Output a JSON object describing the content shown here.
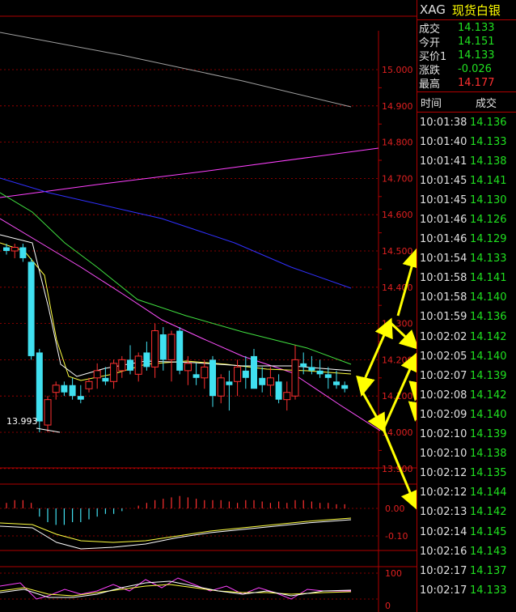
{
  "quote": {
    "symbol": "XAG",
    "name": "现货白银",
    "rows": [
      {
        "label": "成交",
        "value": "14.133",
        "color": "green"
      },
      {
        "label": "今开",
        "value": "14.151",
        "color": "green"
      },
      {
        "label": "买价1",
        "value": "14.133",
        "color": "green"
      },
      {
        "label": "涨跌",
        "value": "-0.026",
        "color": "green"
      },
      {
        "label": "最高",
        "value": "14.177",
        "color": "red"
      }
    ]
  },
  "ticks": {
    "col_time": "时间",
    "col_price": "成交",
    "rows": [
      {
        "time": "10:01:38",
        "price": "14.136"
      },
      {
        "time": "10:01:40",
        "price": "14.133"
      },
      {
        "time": "10:01:41",
        "price": "14.138"
      },
      {
        "time": "10:01:45",
        "price": "14.141"
      },
      {
        "time": "10:01:45",
        "price": "14.130"
      },
      {
        "time": "10:01:46",
        "price": "14.126"
      },
      {
        "time": "10:01:46",
        "price": "14.129"
      },
      {
        "time": "10:01:54",
        "price": "14.133"
      },
      {
        "time": "10:01:58",
        "price": "14.141"
      },
      {
        "time": "10:01:58",
        "price": "14.140"
      },
      {
        "time": "10:01:59",
        "price": "14.136"
      },
      {
        "time": "10:02:02",
        "price": "14.142"
      },
      {
        "time": "10:02:05",
        "price": "14.140"
      },
      {
        "time": "10:02:07",
        "price": "14.139"
      },
      {
        "time": "10:02:08",
        "price": "14.142"
      },
      {
        "time": "10:02:09",
        "price": "14.140"
      },
      {
        "time": "10:02:10",
        "price": "14.139"
      },
      {
        "time": "10:02:10",
        "price": "14.138"
      },
      {
        "time": "10:02:12",
        "price": "14.135"
      },
      {
        "time": "10:02:12",
        "price": "14.144"
      },
      {
        "time": "10:02:13",
        "price": "14.142"
      },
      {
        "time": "10:02:14",
        "price": "14.145"
      },
      {
        "time": "10:02:16",
        "price": "14.143"
      },
      {
        "time": "10:02:17",
        "price": "14.137"
      },
      {
        "time": "10:02:17",
        "price": "14.133"
      }
    ]
  },
  "price_axis": [
    "15.000",
    "14.900",
    "14.800",
    "14.700",
    "14.600",
    "14.500",
    "14.400",
    "14.300",
    "14.200",
    "14.100",
    "14.000",
    "13.900"
  ],
  "low_annotation": "13.993",
  "macd_axis": [
    "0.00",
    "-0.10"
  ],
  "kdj_axis": [
    "100",
    "0"
  ],
  "colors": {
    "grid_red": "#b00000",
    "axis_text": "#e02020",
    "candle_up": "#ff3030",
    "candle_down": "#40e0f0",
    "arrow": "#ffff00",
    "tick_price": "#20e020"
  },
  "candles": [
    {
      "o": 14.51,
      "h": 14.52,
      "l": 14.49,
      "c": 14.5
    },
    {
      "o": 14.5,
      "h": 14.52,
      "l": 14.48,
      "c": 14.51
    },
    {
      "o": 14.51,
      "h": 14.52,
      "l": 14.47,
      "c": 14.48
    },
    {
      "o": 14.47,
      "h": 14.48,
      "l": 14.2,
      "c": 14.21
    },
    {
      "o": 14.22,
      "h": 14.23,
      "l": 14.0,
      "c": 14.03
    },
    {
      "o": 14.02,
      "h": 14.1,
      "l": 14.0,
      "c": 14.09
    },
    {
      "o": 14.11,
      "h": 14.14,
      "l": 14.09,
      "c": 14.13
    },
    {
      "o": 14.13,
      "h": 14.14,
      "l": 14.1,
      "c": 14.11
    },
    {
      "o": 14.13,
      "h": 14.15,
      "l": 14.09,
      "c": 14.1
    },
    {
      "o": 14.1,
      "h": 14.13,
      "l": 14.08,
      "c": 14.09
    },
    {
      "o": 14.12,
      "h": 14.15,
      "l": 14.11,
      "c": 14.14
    },
    {
      "o": 14.15,
      "h": 14.19,
      "l": 14.12,
      "c": 14.17
    },
    {
      "o": 14.15,
      "h": 14.18,
      "l": 14.13,
      "c": 14.14
    },
    {
      "o": 14.14,
      "h": 14.2,
      "l": 14.12,
      "c": 14.19
    },
    {
      "o": 14.17,
      "h": 14.21,
      "l": 14.15,
      "c": 14.2
    },
    {
      "o": 14.2,
      "h": 14.24,
      "l": 14.16,
      "c": 14.17
    },
    {
      "o": 14.16,
      "h": 14.22,
      "l": 14.14,
      "c": 14.21
    },
    {
      "o": 14.22,
      "h": 14.25,
      "l": 14.17,
      "c": 14.18
    },
    {
      "o": 14.18,
      "h": 14.3,
      "l": 14.15,
      "c": 14.28
    },
    {
      "o": 14.27,
      "h": 14.29,
      "l": 14.17,
      "c": 14.2
    },
    {
      "o": 14.2,
      "h": 14.28,
      "l": 14.14,
      "c": 14.27
    },
    {
      "o": 14.28,
      "h": 14.29,
      "l": 14.16,
      "c": 14.17
    },
    {
      "o": 14.17,
      "h": 14.21,
      "l": 14.13,
      "c": 14.19
    },
    {
      "o": 14.16,
      "h": 14.19,
      "l": 14.13,
      "c": 14.15
    },
    {
      "o": 14.15,
      "h": 14.2,
      "l": 14.12,
      "c": 14.18
    },
    {
      "o": 14.2,
      "h": 14.21,
      "l": 14.07,
      "c": 14.1
    },
    {
      "o": 14.1,
      "h": 14.16,
      "l": 14.08,
      "c": 14.15
    },
    {
      "o": 14.14,
      "h": 14.17,
      "l": 14.06,
      "c": 14.13
    },
    {
      "o": 14.14,
      "h": 14.2,
      "l": 14.1,
      "c": 14.18
    },
    {
      "o": 14.17,
      "h": 14.21,
      "l": 14.12,
      "c": 14.15
    },
    {
      "o": 14.21,
      "h": 14.23,
      "l": 14.13,
      "c": 14.12
    },
    {
      "o": 14.15,
      "h": 14.18,
      "l": 14.11,
      "c": 14.13
    },
    {
      "o": 14.13,
      "h": 14.18,
      "l": 14.1,
      "c": 14.15
    },
    {
      "o": 14.14,
      "h": 14.16,
      "l": 14.08,
      "c": 14.09
    },
    {
      "o": 14.09,
      "h": 14.14,
      "l": 14.06,
      "c": 14.11
    },
    {
      "o": 14.1,
      "h": 14.24,
      "l": 14.09,
      "c": 14.2
    },
    {
      "o": 14.19,
      "h": 14.22,
      "l": 14.16,
      "c": 14.18
    },
    {
      "o": 14.18,
      "h": 14.21,
      "l": 14.16,
      "c": 14.17
    },
    {
      "o": 14.17,
      "h": 14.2,
      "l": 14.15,
      "c": 14.16
    },
    {
      "o": 14.16,
      "h": 14.18,
      "l": 14.12,
      "c": 14.15
    },
    {
      "o": 14.14,
      "h": 14.17,
      "l": 14.12,
      "c": 14.13
    },
    {
      "o": 14.13,
      "h": 14.14,
      "l": 14.11,
      "c": 14.12
    }
  ],
  "macd_bars": [
    0.02,
    0.03,
    0.03,
    0.02,
    -0.03,
    -0.05,
    -0.06,
    -0.06,
    -0.05,
    -0.05,
    -0.04,
    -0.03,
    -0.02,
    -0.02,
    -0.01,
    0.0,
    0.01,
    0.02,
    0.03,
    0.035,
    0.04,
    0.045,
    0.04,
    0.035,
    0.03,
    0.03,
    0.03,
    0.025,
    0.02,
    0.03,
    0.03,
    0.025,
    0.02,
    0.025,
    0.02,
    0.03,
    0.03,
    0.025,
    0.02,
    0.02,
    0.015,
    0.015
  ]
}
